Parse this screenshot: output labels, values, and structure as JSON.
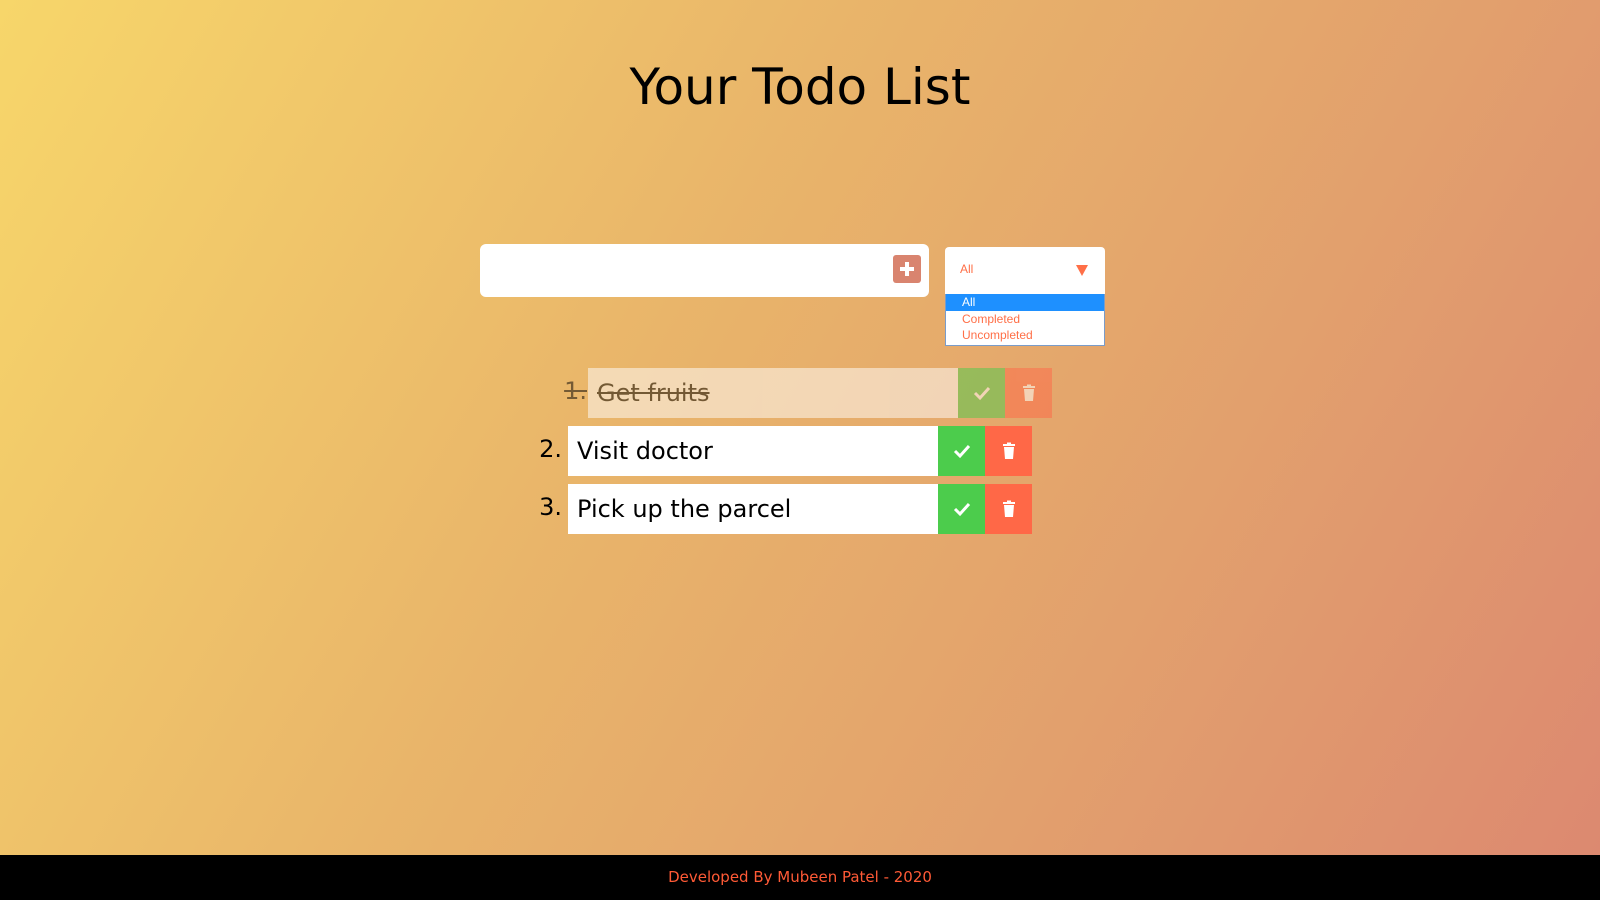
{
  "header": {
    "title": "Your Todo List"
  },
  "add_form": {
    "input_value": "",
    "input_placeholder": "",
    "add_button_icon": "plus-square-icon"
  },
  "filter": {
    "selected": "All",
    "options": [
      "All",
      "Completed",
      "Uncompleted"
    ],
    "highlighted_index": 0
  },
  "todos": [
    {
      "number": "1.",
      "text": "Get fruits",
      "completed": true
    },
    {
      "number": "2.",
      "text": "Visit doctor",
      "completed": false
    },
    {
      "number": "3.",
      "text": "Pick up the parcel",
      "completed": false
    }
  ],
  "icons": {
    "check": "check-icon",
    "trash": "trash-icon"
  },
  "colors": {
    "accent": "#ff6f47",
    "check_button": "#4ccc4c",
    "trash_button": "#ff6847",
    "add_button": "#d9846f",
    "highlight": "#1e90ff",
    "footer_bg": "#000000",
    "footer_text": "#ff5a36"
  },
  "footer": {
    "text": "Developed By Mubeen Patel - 2020"
  }
}
